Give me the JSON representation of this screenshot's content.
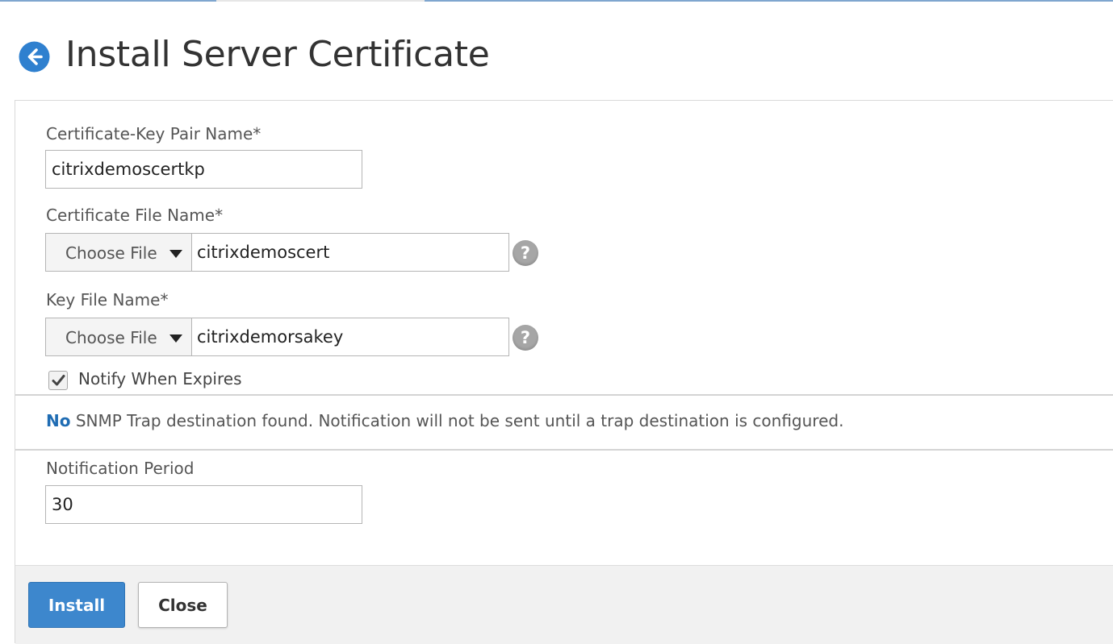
{
  "header": {
    "title": "Install Server Certificate",
    "back_icon": "arrow-left-circle-icon",
    "accent": "#2f80cf"
  },
  "form": {
    "cert_key_pair": {
      "label": "Certificate-Key Pair Name*",
      "value": "citrixdemoscertkp"
    },
    "cert_file": {
      "label": "Certificate File Name*",
      "choose_label": "Choose File",
      "value": "citrixdemoscert",
      "help_icon": "question-mark-icon"
    },
    "key_file": {
      "label": "Key File Name*",
      "choose_label": "Choose File",
      "value": "citrixdemorsakey",
      "help_icon": "question-mark-icon"
    },
    "notify": {
      "label": "Notify When Expires",
      "checked": true
    },
    "snmp_message": {
      "emphasis": "No",
      "text": " SNMP Trap destination found. Notification will not be sent until a trap destination is configured."
    },
    "notification_period": {
      "label": "Notification Period",
      "value": "30"
    }
  },
  "footer": {
    "install_label": "Install",
    "close_label": "Close",
    "install_color": "#3d87cd"
  }
}
